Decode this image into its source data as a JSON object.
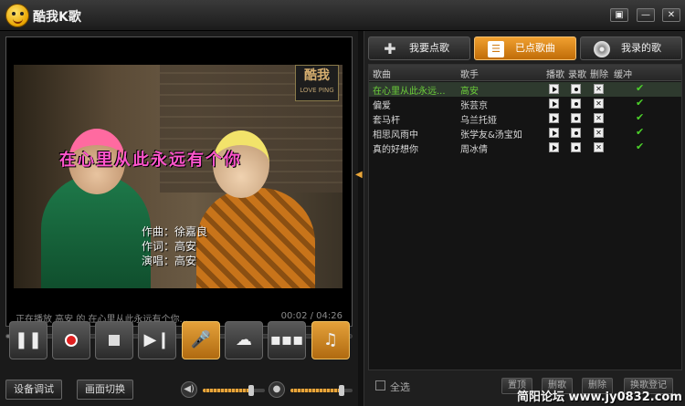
{
  "app": {
    "title": "酷我K歌"
  },
  "window_controls": {
    "skin": "▣",
    "minimize": "—",
    "close": "✕"
  },
  "video": {
    "lyric": "在心里从此永远有个你",
    "credits": [
      "作曲：徐嘉良",
      "作词：高安",
      "演唱：高安"
    ],
    "badge_title": "酷我",
    "badge_sub": "LOVE PING",
    "status": "正在播放 高安 的 在心里从此永远有个你...",
    "time": "00:02 / 04:26"
  },
  "progress": {
    "fraction": 0.01
  },
  "controls": {
    "pause": "❚❚",
    "next": "▶❙",
    "eq": "▪▪▪",
    "note": "♫",
    "mic": "🎤",
    "chat": "☁"
  },
  "bottom": {
    "device_test": "设备调试",
    "screen_switch": "画面切换",
    "speaker_icon": "◀)",
    "mic_icon": "●",
    "music_volume": 0.78,
    "mic_volume": 0.82
  },
  "tabs": [
    {
      "label": "我要点歌",
      "icon": "plus-icon",
      "glyph": "✚"
    },
    {
      "label": "已点歌曲",
      "icon": "list-icon",
      "glyph": "☰"
    },
    {
      "label": "我录的歌",
      "icon": "disc-icon",
      "glyph": ""
    }
  ],
  "table": {
    "headers": {
      "song": "歌曲",
      "singer": "歌手",
      "play": "播歌",
      "record": "录歌",
      "delete": "删除",
      "buffer": "缓冲"
    },
    "rows": [
      {
        "song": "在心里从此永远...",
        "singer": "高安",
        "buffered": "✔"
      },
      {
        "song": "偏爱",
        "singer": "张芸京",
        "buffered": "✔"
      },
      {
        "song": "套马杆",
        "singer": "乌兰托娅",
        "buffered": "✔"
      },
      {
        "song": "相思风雨中",
        "singer": "张学友&汤宝如",
        "buffered": "✔"
      },
      {
        "song": "真的好想你",
        "singer": "周冰倩",
        "buffered": "✔"
      }
    ]
  },
  "footer": {
    "select_all": "全选",
    "btn1": "置顶",
    "btn2": "删歌",
    "btn3": "删除",
    "btn4": "换歌登记"
  },
  "watermark": "简阳论坛 www.jy0832.com"
}
